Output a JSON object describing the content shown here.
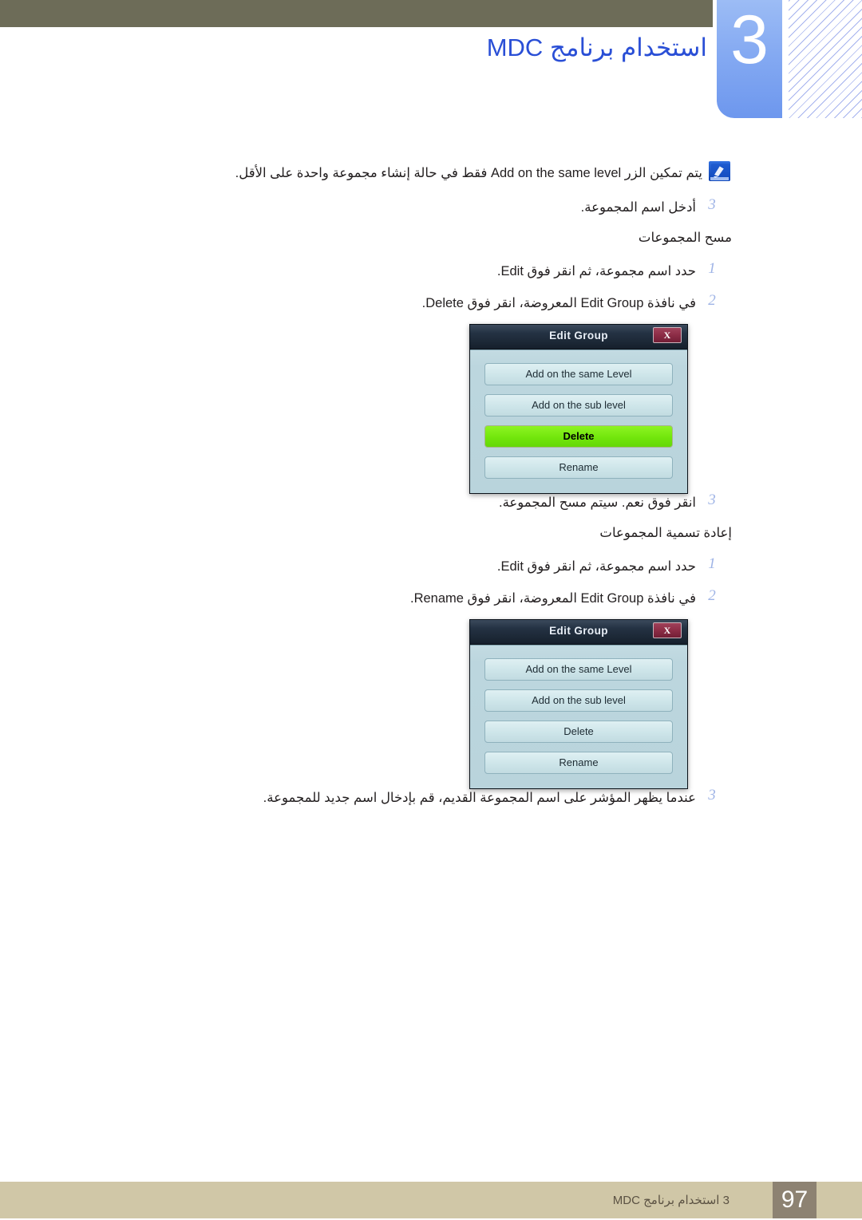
{
  "header": {
    "chapter_number": "3",
    "chapter_title": "استخدام برنامج MDC",
    "bar_color": "#6d6c58",
    "badge_color": "#85aaf2",
    "title_color": "#2a4fd6"
  },
  "note": {
    "icon": "note-pencil-icon",
    "text": "يتم تمكين الزر Add on the same level فقط في حالة إنشاء مجموعة واحدة على الأقل."
  },
  "content_blocks": [
    {
      "kind": "step",
      "num": "3",
      "text": "أدخل اسم المجموعة."
    },
    {
      "kind": "subheading",
      "text": "مسح المجموعات"
    },
    {
      "kind": "step",
      "num": "1",
      "text": "حدد اسم مجموعة، ثم انقر فوق Edit."
    },
    {
      "kind": "step",
      "num": "2",
      "text": "في نافذة Edit Group المعروضة، انقر فوق Delete."
    },
    {
      "kind": "dialog",
      "ref": "dialog_delete"
    },
    {
      "kind": "step",
      "num": "3",
      "text": "انقر فوق نعم. سيتم مسح المجموعة."
    },
    {
      "kind": "subheading",
      "text": "إعادة تسمية المجموعات"
    },
    {
      "kind": "step",
      "num": "1",
      "text": "حدد اسم مجموعة، ثم انقر فوق Edit."
    },
    {
      "kind": "step",
      "num": "2",
      "text": "في نافذة Edit Group المعروضة، انقر فوق Rename."
    },
    {
      "kind": "dialog",
      "ref": "dialog_rename"
    },
    {
      "kind": "step",
      "num": "3",
      "text": "عندما يظهر المؤشر على اسم المجموعة القديم، قم بإدخال اسم جديد للمجموعة."
    }
  ],
  "dialog_delete": {
    "title": "Edit Group",
    "close_label": "X",
    "buttons": [
      {
        "label": "Add on the same Level",
        "highlighted": false
      },
      {
        "label": "Add on the sub level",
        "highlighted": false
      },
      {
        "label": "Delete",
        "highlighted": true
      },
      {
        "label": "Rename",
        "highlighted": false
      }
    ],
    "highlight_color": "#72e60c"
  },
  "dialog_rename": {
    "title": "Edit Group",
    "close_label": "X",
    "buttons": [
      {
        "label": "Add on the same Level",
        "highlighted": false
      },
      {
        "label": "Add on the sub level",
        "highlighted": false
      },
      {
        "label": "Delete",
        "highlighted": false
      },
      {
        "label": "Rename",
        "highlighted": false
      }
    ],
    "highlight_color": "#72e60c"
  },
  "footer": {
    "page_number": "97",
    "text": "3 استخدام برنامج MDC",
    "bar_color": "#d0c7a7",
    "page_box_color": "#8d8272"
  }
}
